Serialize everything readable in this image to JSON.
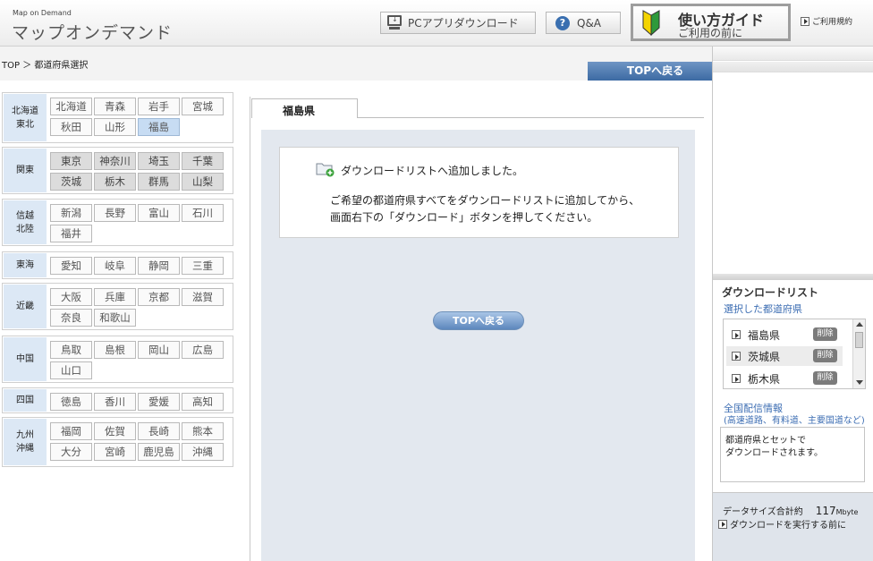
{
  "header": {
    "logo_small": "Map on Demand",
    "logo_title": "マップオンデマンド",
    "pc_app_download": "PCアプリダウンロード",
    "qa": "Q&A",
    "guide_title": "使い方ガイド",
    "guide_subtitle": "ご利用の前に",
    "terms": "ご利用規約"
  },
  "breadcrumb": "TOP ＞ 都道府県選択",
  "top_button": "TOPへ戻る",
  "regions": [
    {
      "label": "北海道\n東北",
      "prefs": [
        {
          "name": "北海道",
          "state": "normal"
        },
        {
          "name": "青森",
          "state": "normal"
        },
        {
          "name": "岩手",
          "state": "normal"
        },
        {
          "name": "宮城",
          "state": "normal"
        },
        {
          "name": "秋田",
          "state": "normal"
        },
        {
          "name": "山形",
          "state": "normal"
        },
        {
          "name": "福島",
          "state": "selected"
        }
      ]
    },
    {
      "label": "関東",
      "prefs": [
        {
          "name": "東京",
          "state": "added"
        },
        {
          "name": "神奈川",
          "state": "added"
        },
        {
          "name": "埼玉",
          "state": "added"
        },
        {
          "name": "千葉",
          "state": "added"
        },
        {
          "name": "茨城",
          "state": "added"
        },
        {
          "name": "栃木",
          "state": "added"
        },
        {
          "name": "群馬",
          "state": "added"
        },
        {
          "name": "山梨",
          "state": "added"
        }
      ]
    },
    {
      "label": "信越\n北陸",
      "prefs": [
        {
          "name": "新潟",
          "state": "normal"
        },
        {
          "name": "長野",
          "state": "normal"
        },
        {
          "name": "富山",
          "state": "normal"
        },
        {
          "name": "石川",
          "state": "normal"
        },
        {
          "name": "福井",
          "state": "normal"
        }
      ]
    },
    {
      "label": "東海",
      "prefs": [
        {
          "name": "愛知",
          "state": "normal"
        },
        {
          "name": "岐阜",
          "state": "normal"
        },
        {
          "name": "静岡",
          "state": "normal"
        },
        {
          "name": "三重",
          "state": "normal"
        }
      ]
    },
    {
      "label": "近畿",
      "prefs": [
        {
          "name": "大阪",
          "state": "normal"
        },
        {
          "name": "兵庫",
          "state": "normal"
        },
        {
          "name": "京都",
          "state": "normal"
        },
        {
          "name": "滋賀",
          "state": "normal"
        },
        {
          "name": "奈良",
          "state": "normal"
        },
        {
          "name": "和歌山",
          "state": "normal"
        }
      ]
    },
    {
      "label": "中国",
      "prefs": [
        {
          "name": "鳥取",
          "state": "normal"
        },
        {
          "name": "島根",
          "state": "normal"
        },
        {
          "name": "岡山",
          "state": "normal"
        },
        {
          "name": "広島",
          "state": "normal"
        },
        {
          "name": "山口",
          "state": "normal"
        }
      ]
    },
    {
      "label": "四国",
      "prefs": [
        {
          "name": "徳島",
          "state": "normal"
        },
        {
          "name": "香川",
          "state": "normal"
        },
        {
          "name": "愛媛",
          "state": "normal"
        },
        {
          "name": "高知",
          "state": "normal"
        }
      ]
    },
    {
      "label": "九州\n沖縄",
      "prefs": [
        {
          "name": "福岡",
          "state": "normal"
        },
        {
          "name": "佐賀",
          "state": "normal"
        },
        {
          "name": "長崎",
          "state": "normal"
        },
        {
          "name": "熊本",
          "state": "normal"
        },
        {
          "name": "大分",
          "state": "normal"
        },
        {
          "name": "宮崎",
          "state": "normal"
        },
        {
          "name": "鹿児島",
          "state": "normal"
        },
        {
          "name": "沖縄",
          "state": "normal"
        }
      ]
    }
  ],
  "center": {
    "tab_label": "福島県",
    "message_added": "ダウンロードリストへ追加しました。",
    "message_line2": "ご希望の都道府県すべてをダウンロードリストに追加してから、",
    "message_line3": "画面右下の「ダウンロード」ボタンを押してください。",
    "top_button": "TOPへ戻る"
  },
  "download_list": {
    "title": "ダウンロードリスト",
    "subtitle": "選択した都道府県",
    "items": [
      {
        "name": "福島県",
        "delete": "削除"
      },
      {
        "name": "茨城県",
        "delete": "削除"
      },
      {
        "name": "栃木県",
        "delete": "削除"
      }
    ]
  },
  "national_info": {
    "title": "全国配信情報",
    "subtitle": "(高速道路、有料道、主要国道など)",
    "note_line1": "都道府県とセットで",
    "note_line2": "ダウンロードされます。"
  },
  "data_size": {
    "label": "データサイズ合計約",
    "value": "117",
    "unit": "Mbyte",
    "before_download": "ダウンロードを実行する前に"
  },
  "colors": {
    "accent_blue": "#3c6aa3",
    "link_blue": "#3d6eb3",
    "region_label_bg": "#dce8f5",
    "selected_pref_bg": "#c7dcf3",
    "added_pref_bg": "#dcdcdc"
  }
}
